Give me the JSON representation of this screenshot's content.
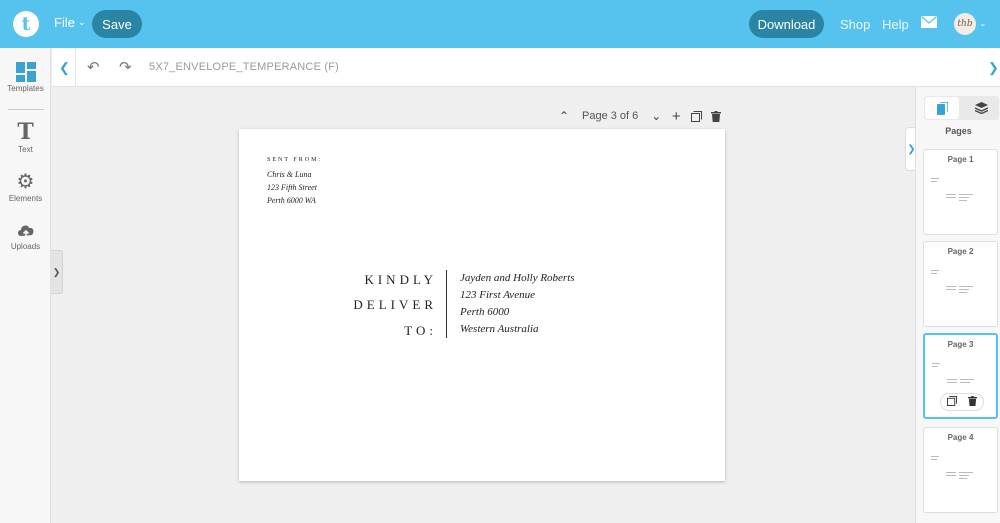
{
  "app": {
    "logo_letter": "t",
    "file_menu": "File",
    "save_label": "Save",
    "download_label": "Download",
    "nav": [
      "Shop",
      "Help"
    ],
    "avatar_text": "thb",
    "accent": "#56c3ee",
    "button_color": "#2a84a3"
  },
  "sidebar": {
    "items": [
      {
        "label": "Templates",
        "icon": "templates-icon"
      },
      {
        "label": "Text",
        "icon": "text-icon"
      },
      {
        "label": "Elements",
        "icon": "gear-icon"
      },
      {
        "label": "Uploads",
        "icon": "upload-cloud-icon"
      }
    ]
  },
  "toolbar": {
    "document_name": "5X7_ENVELOPE_TEMPERANCE (F)"
  },
  "canvas": {
    "page_indicator": "Page 3 of 6"
  },
  "envelope": {
    "sent_from_label": "SENT FROM:",
    "sender_lines": [
      "Chris & Luna",
      "123 Fifth Street",
      "Perth 6000 WA"
    ],
    "heading_lines": [
      "KINDLY",
      "DELIVER",
      "TO:"
    ],
    "recipient_lines": [
      "Jayden and Holly Roberts",
      "123 First Avenue",
      "Perth 6000",
      "Western Australia"
    ]
  },
  "pages_panel": {
    "title": "Pages",
    "thumbnails": [
      "Page 1",
      "Page 2",
      "Page 3",
      "Page 4"
    ],
    "active_page": 3
  }
}
